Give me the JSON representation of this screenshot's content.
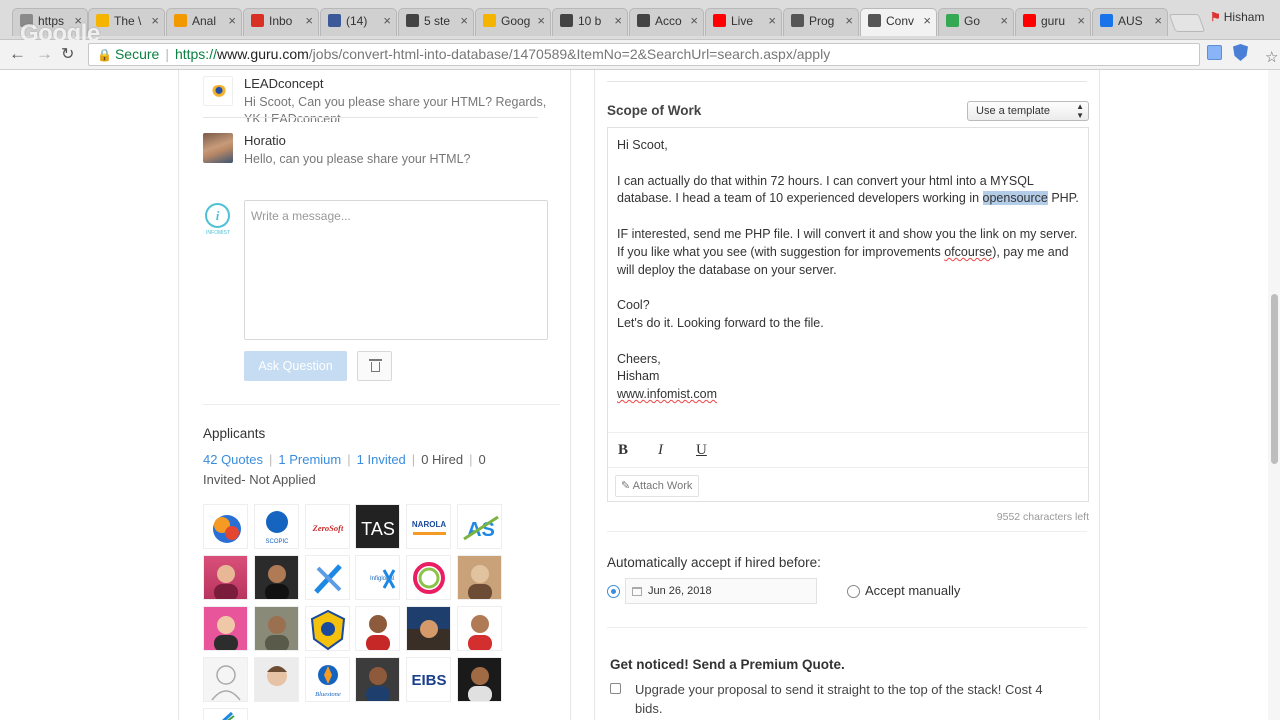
{
  "browser": {
    "tabs": [
      {
        "label": "https",
        "icon": "document-icon",
        "color": "#8a8a8a"
      },
      {
        "label": "The \\",
        "icon": "lightbulb-icon",
        "color": "#f5b400"
      },
      {
        "label": "Anal",
        "icon": "analytics-icon",
        "color": "#f29900"
      },
      {
        "label": "Inbo",
        "icon": "gmail-icon",
        "color": "#d93025"
      },
      {
        "label": "(14)",
        "icon": "facebook-icon",
        "color": "#3b5998"
      },
      {
        "label": "5 ste",
        "icon": "circle-icon",
        "color": "#444444"
      },
      {
        "label": "Goog",
        "icon": "drive-icon",
        "color": "#f4b400"
      },
      {
        "label": "10 b",
        "icon": "circle-icon",
        "color": "#444444"
      },
      {
        "label": "Acco",
        "icon": "circle-icon",
        "color": "#444444"
      },
      {
        "label": "Live",
        "icon": "youtube-icon",
        "color": "#ff0000"
      },
      {
        "label": "Prog",
        "icon": "guru-icon",
        "color": "#555555"
      },
      {
        "label": "Conv",
        "icon": "guru-icon",
        "color": "#555555"
      },
      {
        "label": "Go",
        "icon": "green-dot-icon",
        "color": "#34a853"
      },
      {
        "label": "guru",
        "icon": "youtube-icon",
        "color": "#ff0000"
      },
      {
        "label": "AUS",
        "icon": "globe-icon",
        "color": "#1a73e8"
      }
    ],
    "user": "Hisham",
    "watermark": "Google",
    "url": {
      "secure_label": "Secure",
      "scheme": "https://",
      "domain": "www.guru.com",
      "path": "/jobs/convert-html-into-database/1470589&ItemNo=2&SearchUrl=search.aspx/apply"
    }
  },
  "messages": [
    {
      "name": "LEADconcept",
      "text": "Hi Scoot, Can you please share your HTML? Regards, YK LEADconcept"
    },
    {
      "name": "Horatio",
      "text": "Hello, can you please share your HTML?"
    }
  ],
  "compose": {
    "placeholder": "Write a message...",
    "ask_label": "Ask Question",
    "avatar_caption": "INFOMIST"
  },
  "applicants": {
    "title": "Applicants",
    "quotes": "42 Quotes",
    "premium": "1 Premium",
    "invited": "1 Invited",
    "hired": "0 Hired",
    "invited_not_applied": "0",
    "invited_not_applied_label": "Invited- Not Applied",
    "logos": [
      "SCOPIC",
      "ZeroSoft",
      "TAS",
      "NAROLA",
      "AS",
      "Infiglobal",
      "Bluestone",
      "EIBS"
    ]
  },
  "scope": {
    "title": "Scope of Work",
    "template_label": "Use a template",
    "greeting": "Hi Scoot,",
    "para1_a": "I can actually do that within 72 hours. I can convert your html into a MYSQL database. I head a team of 10 experienced developers working in ",
    "para1_hl": "opensource",
    "para1_b": " PHP.",
    "para2_a": "IF interested, send me PHP file. I will convert it and show you the link on my server. If you like what you see (with suggestion for improvements ",
    "para2_sq": "ofcourse",
    "para2_b": "), pay me and will deploy the database on your server.",
    "line_cool": "Cool?",
    "line_doit": "Let's do it. Looking forward to the file.",
    "cheers": "Cheers,",
    "signoff": "Hisham",
    "website": "www.infomist.com",
    "bold": "B",
    "italic": "I",
    "underline": "U",
    "attach_label": "Attach Work",
    "chars_left": "9552 characters left"
  },
  "accept": {
    "title": "Automatically accept if hired before:",
    "date": "Jun 26, 2018",
    "manual_label": "Accept manually"
  },
  "premium_quote": {
    "title": "Get noticed! Send a Premium Quote.",
    "text": "Upgrade your proposal to send it straight to the top of the stack! Cost 4 bids."
  }
}
